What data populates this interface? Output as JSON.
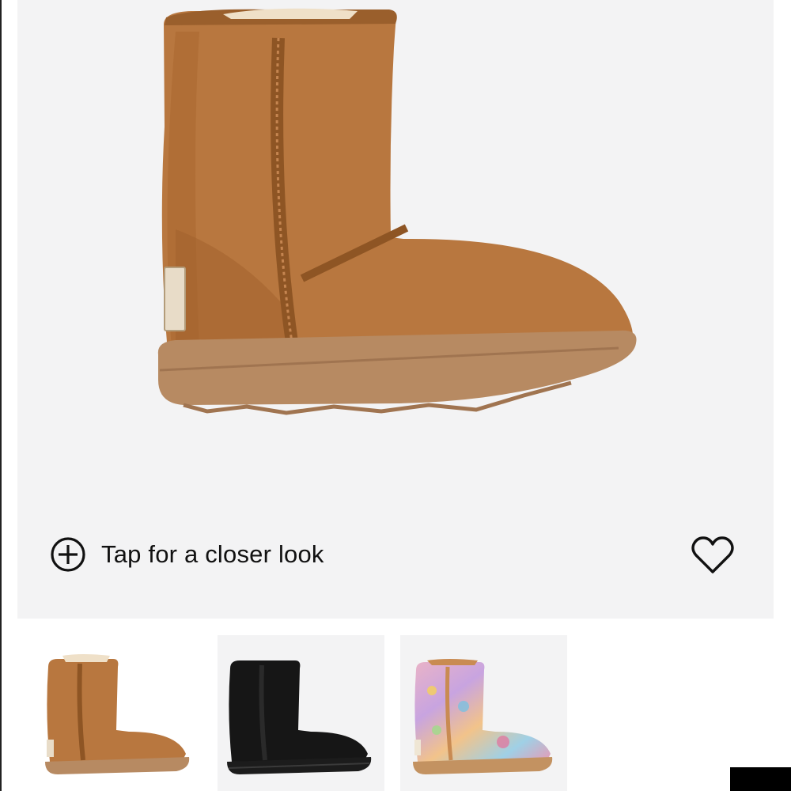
{
  "product": {
    "image_alt": "Chestnut classic short boot",
    "zoom_label": "Tap for a closer look",
    "zoom_icon": "plus-circle-icon",
    "favorite_icon": "heart-outline-icon"
  },
  "thumbnails": [
    {
      "name": "chestnut",
      "color": "#b5743f"
    },
    {
      "name": "black",
      "color": "#1a1a1a"
    },
    {
      "name": "multicolor",
      "color": "#d88fa8"
    }
  ],
  "colors": {
    "hero_bg": "#f3f3f4",
    "boot_chestnut": "#b5743f",
    "sole": "#b98a62",
    "text": "#111111"
  }
}
